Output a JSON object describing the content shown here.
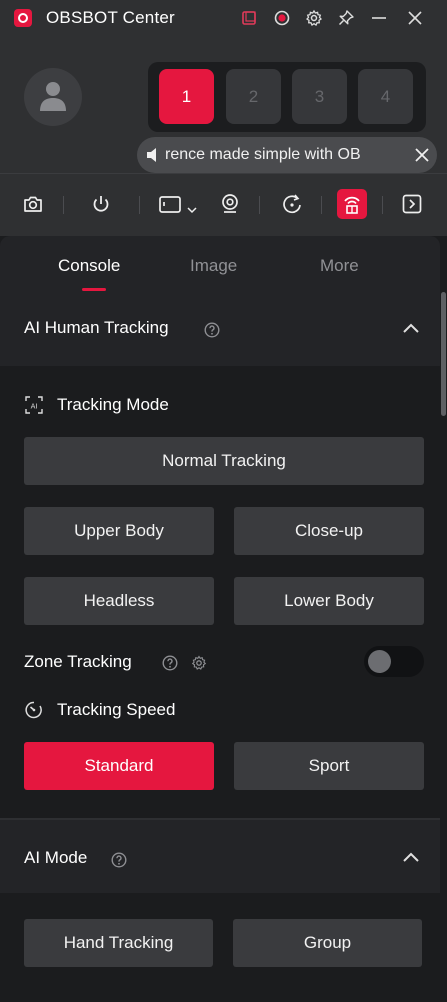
{
  "window": {
    "title": "OBSBOT Center",
    "logo_icon": "obsbot-logo",
    "controls": [
      "snapshot-frame-icon",
      "record-icon",
      "gear-icon",
      "pin-icon",
      "minimize-icon",
      "close-icon"
    ]
  },
  "header": {
    "avatar_icon": "user-avatar-icon",
    "presets": [
      "1",
      "2",
      "3",
      "4"
    ],
    "active_preset": "1",
    "banner_text": "rence made simple with OB",
    "banner_icon": "speaker-icon"
  },
  "toolbar": {
    "tools": [
      "camera-icon",
      "power-icon",
      "camera-view-icon",
      "webcam-icon",
      "rotate-icon",
      "ai-tracking-icon",
      "collapse-panel-icon"
    ],
    "active_tool": "ai-tracking-icon"
  },
  "tabs": {
    "console": "Console",
    "image": "Image",
    "more": "More",
    "active": "Console"
  },
  "ai_tracking": {
    "section_title": "AI Human Tracking",
    "mode_label": "Tracking Mode",
    "modes": {
      "normal": "Normal Tracking",
      "upper_body": "Upper Body",
      "close_up": "Close-up",
      "headless": "Headless",
      "lower_body": "Lower Body"
    },
    "zone_label": "Zone Tracking",
    "zone_enabled": false,
    "speed_label": "Tracking Speed",
    "speeds": {
      "standard": "Standard",
      "sport": "Sport"
    },
    "selected_speed": "Standard"
  },
  "ai_mode": {
    "section_title": "AI Mode",
    "buttons": {
      "hand_tracking": "Hand Tracking",
      "group": "Group"
    }
  },
  "colors": {
    "accent": "#e5173f",
    "background": "#1b1c1e",
    "surface": "#2f3032"
  }
}
